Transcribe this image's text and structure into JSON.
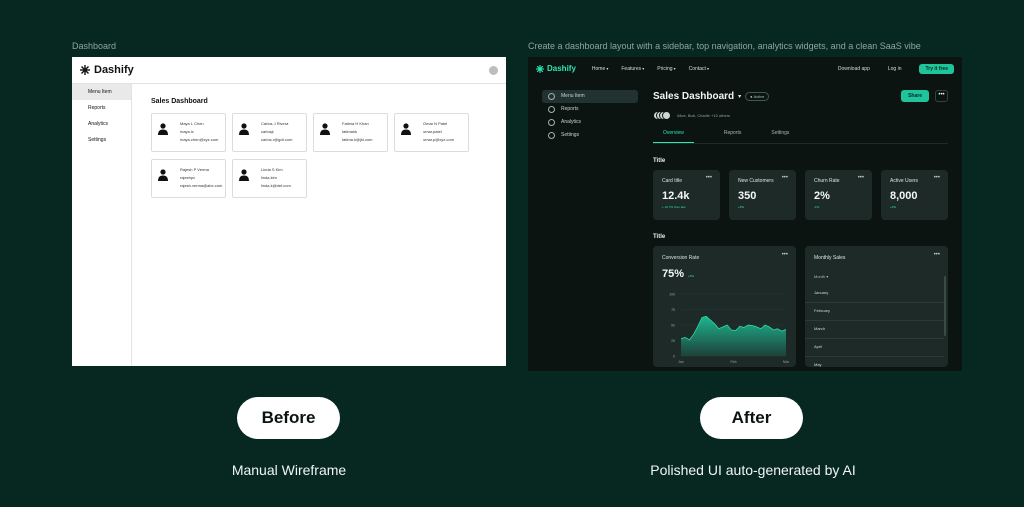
{
  "left_caption": "Dashboard",
  "right_caption": "Create a dashboard layout with a sidebar, top navigation, analytics widgets, and a clean SaaS vibe",
  "wireframe": {
    "brand": "Dashify",
    "sidebar": [
      "Menu Item",
      "Reports",
      "Analytics",
      "Settings"
    ],
    "title": "Sales Dashboard",
    "cards": [
      {
        "name": "Maya L Chen",
        "user": "maya.lc",
        "email": "maya.chen@xyz.com"
      },
      {
        "name": "Carlos J Rivera",
        "user": "carlosjr",
        "email": "carlos.r@gdt.com"
      },
      {
        "name": "Fatima H Khan",
        "user": "fatimahk",
        "email": "fatima.k@jkl.com"
      },
      {
        "name": "Omar N Patel",
        "user": "omar.patel",
        "email": "omar.p@xyz.com"
      },
      {
        "name": "Rajesh P Verma",
        "user": "rajeshpv",
        "email": "rajesh.verma@abc.com"
      },
      {
        "name": "Linda S Kim",
        "user": "linda.kim",
        "email": "linda.k@def.com"
      }
    ]
  },
  "dashboard": {
    "brand": "Dashify",
    "nav": [
      "Home",
      "Features",
      "Pricing",
      "Contact"
    ],
    "download": "Download app",
    "login": "Log in",
    "try": "Try it free",
    "sidebar": [
      "Menu Item",
      "Reports",
      "Analytics",
      "Settings"
    ],
    "title": "Sales Dashboard",
    "status": "Active",
    "share": "Share",
    "users_text": "Alice, Bob, Charlie +10 others",
    "tabs": [
      "Overview",
      "Reports",
      "Settings"
    ],
    "section1": "Title",
    "section2": "Title",
    "stats": [
      {
        "title": "Card title",
        "value": "12.4k",
        "delta": "+ 10.7% from last"
      },
      {
        "title": "New Customers",
        "value": "350",
        "delta": "+5%"
      },
      {
        "title": "Churn Rate",
        "value": "2%",
        "delta": "-1%"
      },
      {
        "title": "Active Users",
        "value": "8,000",
        "delta": "+3%"
      }
    ],
    "conversion": {
      "title": "Conversion Rate",
      "value": "75%",
      "delta": "+5%"
    },
    "monthly": {
      "title": "Monthly Sales",
      "select": "Month",
      "months": [
        "January",
        "February",
        "March",
        "April",
        "May"
      ]
    },
    "more": "•••"
  },
  "chart_data": {
    "type": "area",
    "x_ticks": [
      "Jan",
      "Feb",
      "Mar"
    ],
    "y_ticks": [
      0,
      25,
      50,
      75,
      100
    ],
    "ylim": [
      0,
      100
    ],
    "values": [
      28,
      30,
      26,
      35,
      48,
      62,
      64,
      58,
      52,
      44,
      47,
      50,
      42,
      41,
      48,
      46,
      50,
      49,
      47,
      44,
      50,
      47,
      42,
      44,
      40,
      43
    ]
  },
  "before_label": "Before",
  "after_label": "After",
  "left_sub": "Manual Wireframe",
  "right_sub": "Polished UI auto-generated by AI"
}
